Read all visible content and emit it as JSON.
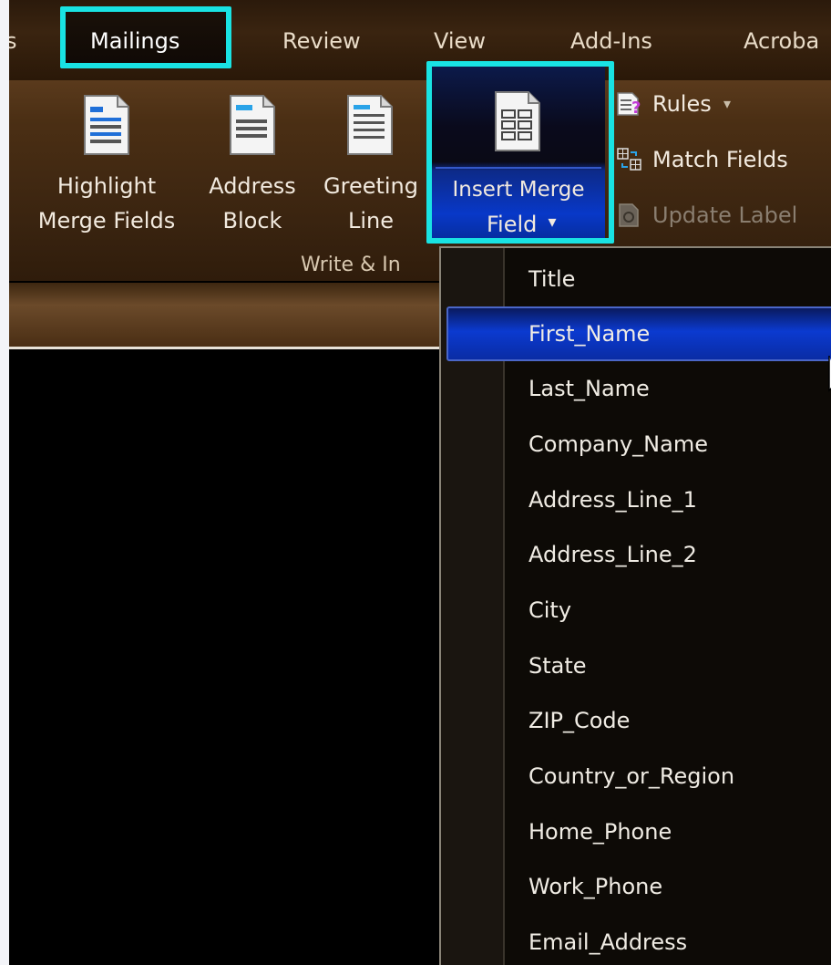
{
  "tabs": {
    "partial": "s",
    "mailings": "Mailings",
    "review": "Review",
    "view": "View",
    "addins": "Add-Ins",
    "acrobat": "Acroba"
  },
  "ribbon": {
    "highlight": {
      "line1": "Highlight",
      "line2": "Merge Fields",
      "icon": "highlight-merge-fields-icon"
    },
    "address": {
      "line1": "Address",
      "line2": "Block",
      "icon": "address-block-icon"
    },
    "greeting": {
      "line1": "Greeting",
      "line2": "Line",
      "icon": "greeting-line-icon"
    },
    "insert": {
      "line1": "Insert Merge",
      "line2": "Field",
      "arrow": "▾",
      "icon": "insert-merge-field-icon"
    },
    "rules": {
      "label": "Rules",
      "arrow": "▾",
      "icon": "rules-icon"
    },
    "match": {
      "label": "Match Fields",
      "icon": "match-fields-icon"
    },
    "update": {
      "label": "Update Label",
      "icon": "update-labels-icon"
    },
    "group_label": "Write & In"
  },
  "dropdown": {
    "items": [
      "Title",
      "First_Name",
      "Last_Name",
      "Company_Name",
      "Address_Line_1",
      "Address_Line_2",
      "City",
      "State",
      "ZIP_Code",
      "Country_or_Region",
      "Home_Phone",
      "Work_Phone",
      "Email_Address"
    ],
    "selected_index": 1
  },
  "colors": {
    "highlight_outline": "#19e3e3",
    "selection": "#0b3ad0",
    "ribbon": "#4b2f14"
  }
}
